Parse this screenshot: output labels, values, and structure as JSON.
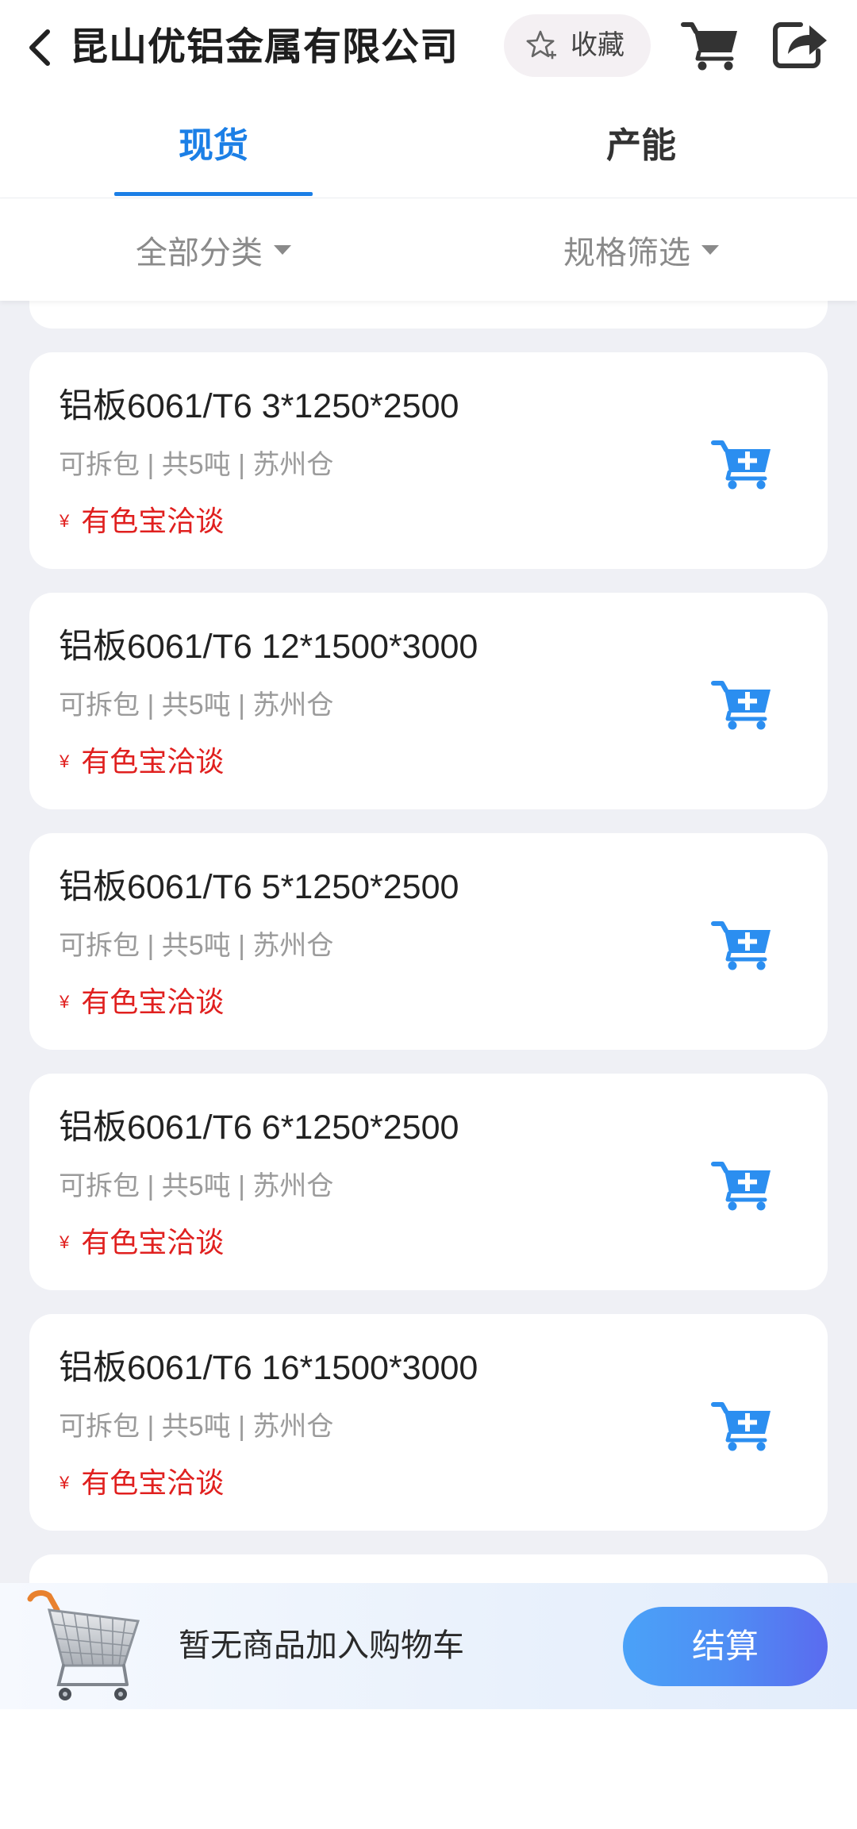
{
  "header": {
    "title": "昆山优铝金属有限公司",
    "favorite_label": "收藏",
    "icons": {
      "back": "chevron-left-icon",
      "favorite": "star-plus-icon",
      "cart": "shopping-cart-icon",
      "share": "share-icon"
    }
  },
  "tabs": [
    {
      "label": "现货",
      "active": true
    },
    {
      "label": "产能",
      "active": false
    }
  ],
  "filters": [
    {
      "label": "全部分类",
      "icon": "caret-down-icon"
    },
    {
      "label": "规格筛选",
      "icon": "caret-down-icon"
    }
  ],
  "products": [
    {
      "title": "铝板6061/T6 3*1250*2500",
      "meta": "可拆包 | 共5吨 | 苏州仓",
      "currency": "¥",
      "price": "有色宝洽谈"
    },
    {
      "title": "铝板6061/T6 12*1500*3000",
      "meta": "可拆包 | 共5吨 | 苏州仓",
      "currency": "¥",
      "price": "有色宝洽谈"
    },
    {
      "title": "铝板6061/T6 5*1250*2500",
      "meta": "可拆包 | 共5吨 | 苏州仓",
      "currency": "¥",
      "price": "有色宝洽谈"
    },
    {
      "title": "铝板6061/T6 6*1250*2500",
      "meta": "可拆包 | 共5吨 | 苏州仓",
      "currency": "¥",
      "price": "有色宝洽谈"
    },
    {
      "title": "铝板6061/T6 16*1500*3000",
      "meta": "可拆包 | 共5吨 | 苏州仓",
      "currency": "¥",
      "price": "有色宝洽谈"
    }
  ],
  "cart_bar": {
    "empty_text": "暂无商品加入购物车",
    "checkout_label": "结算",
    "icon": "shopping-trolley-icon"
  },
  "colors": {
    "accent": "#1b7fe6",
    "price": "#e0201f",
    "muted": "#9b9b9b",
    "list_background": "#eff0f5",
    "add_cart_icon": "#2b8ef0"
  }
}
